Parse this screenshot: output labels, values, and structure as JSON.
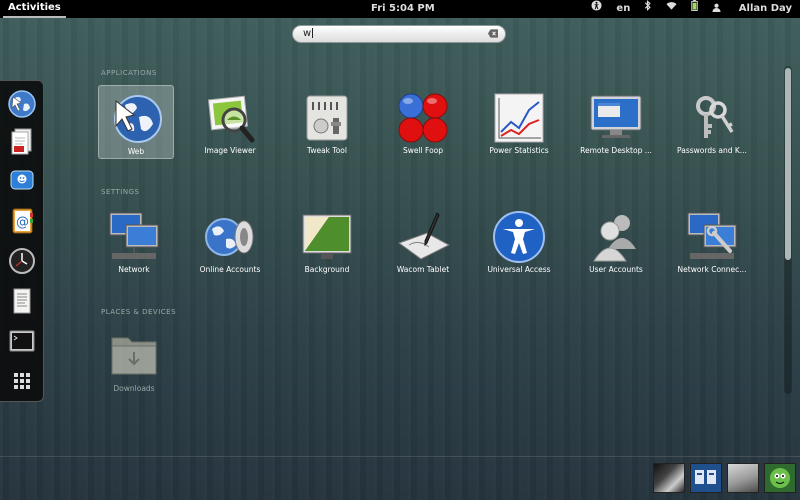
{
  "topbar": {
    "activities": "Activities",
    "clock": "Fri  5:04 PM",
    "language": "en",
    "user": "Allan Day",
    "icons": [
      "accessibility-icon",
      "bluetooth-icon",
      "wifi-icon",
      "battery-icon",
      "user-icon"
    ]
  },
  "search": {
    "value": "w"
  },
  "dash": {
    "items": [
      "web-browser-icon",
      "document-viewer-icon",
      "empathy-chat-icon",
      "contacts-icon",
      "clock-icon",
      "text-editor-icon",
      "terminal-icon",
      "show-applications-icon"
    ]
  },
  "sections": {
    "applications": "APPLICATIONS",
    "settings": "SETTINGS",
    "places": "PLACES & DEVICES"
  },
  "applications": [
    {
      "label": "Web",
      "icon": "web-globe-icon"
    },
    {
      "label": "Image Viewer",
      "icon": "image-viewer-icon"
    },
    {
      "label": "Tweak Tool",
      "icon": "tweak-tool-icon"
    },
    {
      "label": "Swell Foop",
      "icon": "swell-foop-icon"
    },
    {
      "label": "Power Statistics",
      "icon": "power-statistics-icon"
    },
    {
      "label": "Remote Desktop ...",
      "icon": "remote-desktop-icon"
    },
    {
      "label": "Passwords and K...",
      "icon": "keys-icon"
    }
  ],
  "settings": [
    {
      "label": "Network",
      "icon": "network-icon"
    },
    {
      "label": "Online Accounts",
      "icon": "online-accounts-icon"
    },
    {
      "label": "Background",
      "icon": "background-icon"
    },
    {
      "label": "Wacom Tablet",
      "icon": "wacom-tablet-icon"
    },
    {
      "label": "Universal Access",
      "icon": "universal-access-icon"
    },
    {
      "label": "User Accounts",
      "icon": "user-accounts-icon"
    },
    {
      "label": "Network Connec...",
      "icon": "network-connections-icon"
    }
  ],
  "places": [
    {
      "label": "Downloads",
      "icon": "downloads-folder-icon"
    }
  ],
  "message_tray": [
    "contact-avatar-1",
    "contact-avatar-2",
    "contact-avatar-3",
    "contact-avatar-4"
  ],
  "colors": {
    "accent": "#2f6bc4",
    "topbar": "#000000",
    "selected": "#c8d2d2"
  }
}
